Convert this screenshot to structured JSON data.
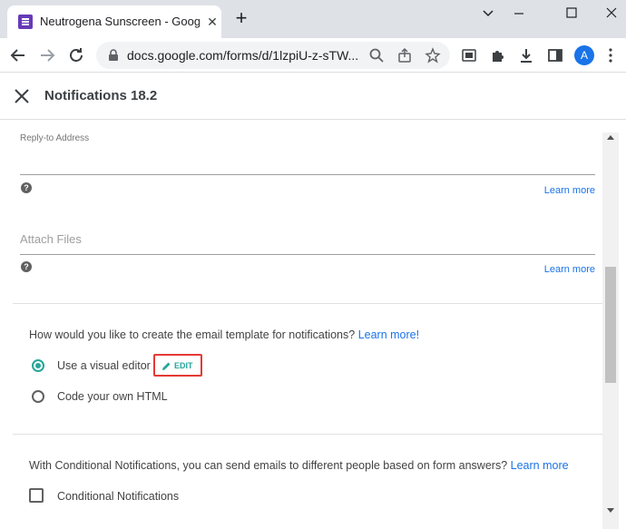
{
  "browser": {
    "tab_title": "Neutrogena Sunscreen - Google",
    "url": "docs.google.com/forms/d/1lzpiU-z-sTW...",
    "avatar_letter": "A"
  },
  "header": {
    "title": "Notifications 18.2"
  },
  "form": {
    "reply_to_label": "Reply-to Address",
    "reply_to_value": "",
    "learn_more_1": "Learn more",
    "attach_files_placeholder": "Attach Files",
    "learn_more_2": "Learn more",
    "template_question": "How would you like to create the email template for notifications?",
    "template_question_link": "Learn more!",
    "option_visual": "Use a visual editor",
    "edit_label": "EDIT",
    "option_html": "Code your own HTML",
    "conditional_text": "With Conditional Notifications, you can send emails to different people based on form answers?",
    "conditional_link": "Learn more",
    "conditional_checkbox_label": "Conditional Notifications"
  },
  "colors": {
    "accent": "#26a69a",
    "link": "#1a73e8",
    "highlight": "#e53935",
    "favicon": "#673ab7"
  }
}
